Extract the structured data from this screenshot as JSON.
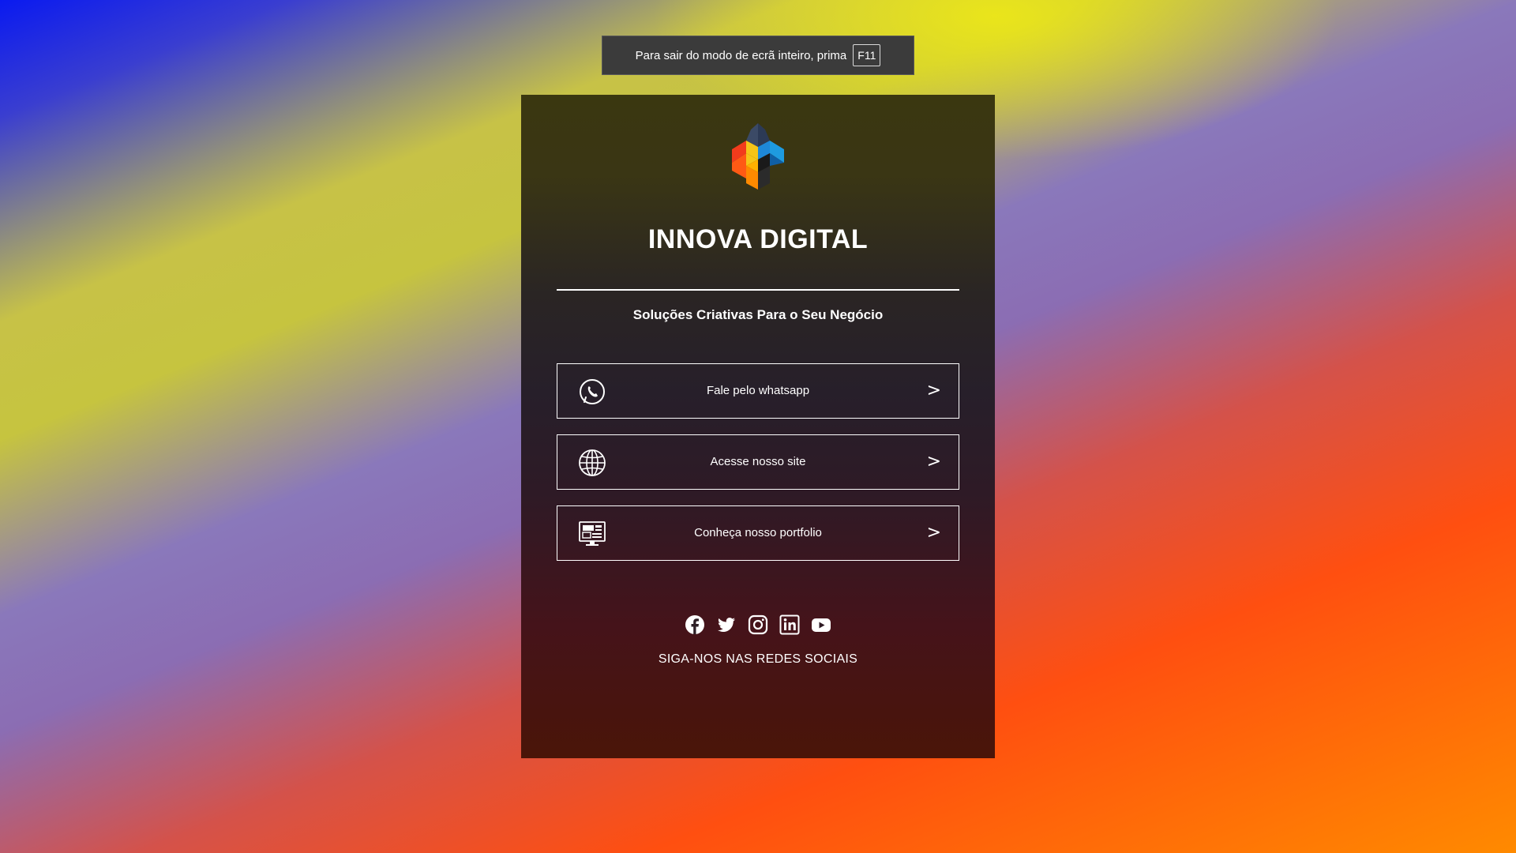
{
  "fullscreen_notice": {
    "text": "Para sair do modo de ecrã inteiro, prima",
    "key": "F11"
  },
  "brand": {
    "logo_icon": "cube-logo-icon",
    "name": "INNOVA DIGITAL",
    "tagline": "Soluções Criativas Para o Seu Negócio"
  },
  "links": [
    {
      "icon": "whatsapp-icon",
      "label": "Fale pelo whatsapp",
      "arrow": ">"
    },
    {
      "icon": "globe-icon",
      "label": "Acesse nosso site",
      "arrow": ">"
    },
    {
      "icon": "portfolio-monitor-icon",
      "label": "Conheça nosso portfolio",
      "arrow": ">"
    }
  ],
  "social": {
    "icons": [
      "facebook-icon",
      "twitter-icon",
      "instagram-icon",
      "linkedin-icon",
      "youtube-icon"
    ],
    "caption": "SIGA-NOS NAS REDES SOCIAIS"
  },
  "colors": {
    "card_top": "#3a3710",
    "card_bottom": "#4a1508",
    "logo_blue": "#1e88d8",
    "logo_orange": "#ff8a00",
    "logo_red": "#f23b1c",
    "logo_yellow": "#f5c518",
    "logo_dark": "#3b4a66"
  }
}
